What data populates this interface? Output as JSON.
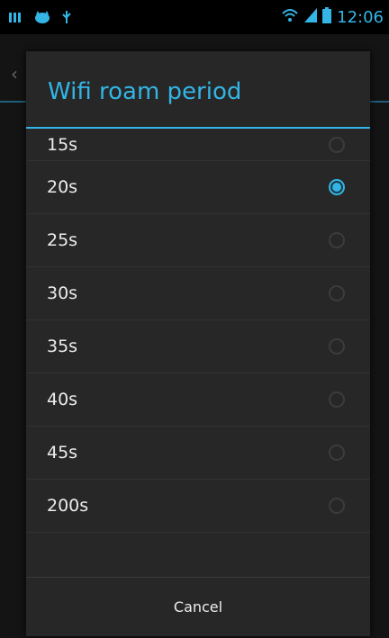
{
  "status_bar": {
    "left_icons": [
      "bars-icon",
      "cat-icon",
      "usb-icon"
    ],
    "right_icons": [
      "wifi-icon",
      "signal-icon",
      "battery-icon"
    ],
    "time": "12:06"
  },
  "dialog": {
    "title": "Wifi roam period",
    "options": [
      {
        "label": "15s",
        "selected": false
      },
      {
        "label": "20s",
        "selected": true
      },
      {
        "label": "25s",
        "selected": false
      },
      {
        "label": "30s",
        "selected": false
      },
      {
        "label": "35s",
        "selected": false
      },
      {
        "label": "40s",
        "selected": false
      },
      {
        "label": "45s",
        "selected": false
      },
      {
        "label": "200s",
        "selected": false
      }
    ],
    "cancel_label": "Cancel"
  },
  "colors": {
    "accent": "#33b5e5",
    "dialog_bg": "#272727",
    "text": "#ececec"
  }
}
